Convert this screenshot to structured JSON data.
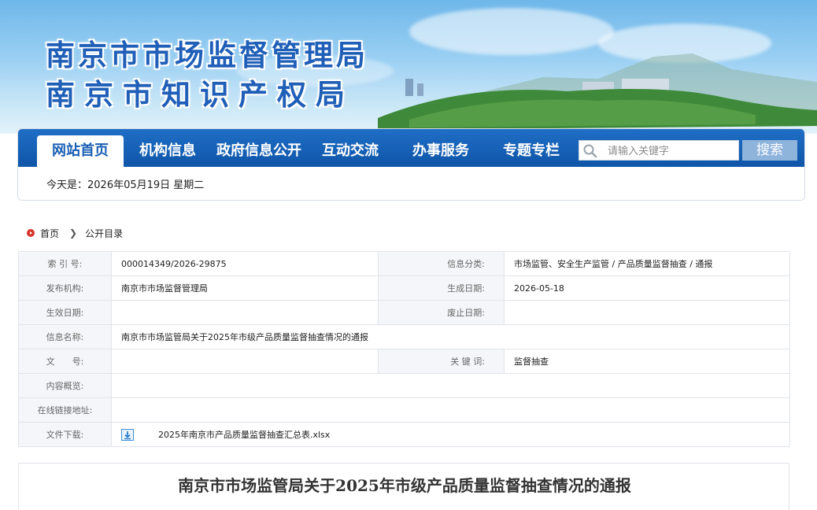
{
  "header": {
    "title_line1": "南京市市场监督管理局",
    "title_line2": "南京市知识产权局"
  },
  "nav": {
    "items": [
      {
        "label": "网站首页",
        "active": true
      },
      {
        "label": "机构信息",
        "active": false
      },
      {
        "label": "政府信息公开",
        "active": false
      },
      {
        "label": "互动交流",
        "active": false
      },
      {
        "label": "办事服务",
        "active": false
      },
      {
        "label": "专题专栏",
        "active": false
      }
    ],
    "search_placeholder": "请输入关键字",
    "search_button": "搜索",
    "date_text": "今天是：2026年05月19日 星期二"
  },
  "breadcrumb": {
    "home": "首页",
    "current": "公开目录"
  },
  "info": {
    "index_label": "索 引 号:",
    "index_value": "000014349/2026-29875",
    "category_label": "信息分类:",
    "category_value": "市场监管、安全生产监管 / 产品质量监督抽查 / 通报",
    "publisher_label": "发布机构:",
    "publisher_value": "南京市市场监督管理局",
    "created_label": "生成日期:",
    "created_value": "2026-05-18",
    "effective_label": "生效日期:",
    "effective_value": "",
    "expiry_label": "废止日期:",
    "expiry_value": "",
    "name_label": "信息名称:",
    "name_value": "南京市市场监管局关于2025年市级产品质量监督抽查情况的通报",
    "docno_label": "文　　号:",
    "docno_value": "",
    "keywords_label": "关 键 词:",
    "keywords_value": "监督抽查",
    "summary_label": "内容概览:",
    "summary_value": "",
    "link_label": "在线链接地址:",
    "link_value": "",
    "download_label": "文件下载:",
    "download_value": "2025年南京市产品质量监督抽查汇总表.xlsx"
  },
  "article": {
    "title": "南京市市场监管局关于2025年市级产品质量监督抽查情况的通报"
  },
  "colors": {
    "nav_blue": "#1a5fb4",
    "title_blue": "#1f5fb8",
    "search_button": "#8fb4dc"
  }
}
